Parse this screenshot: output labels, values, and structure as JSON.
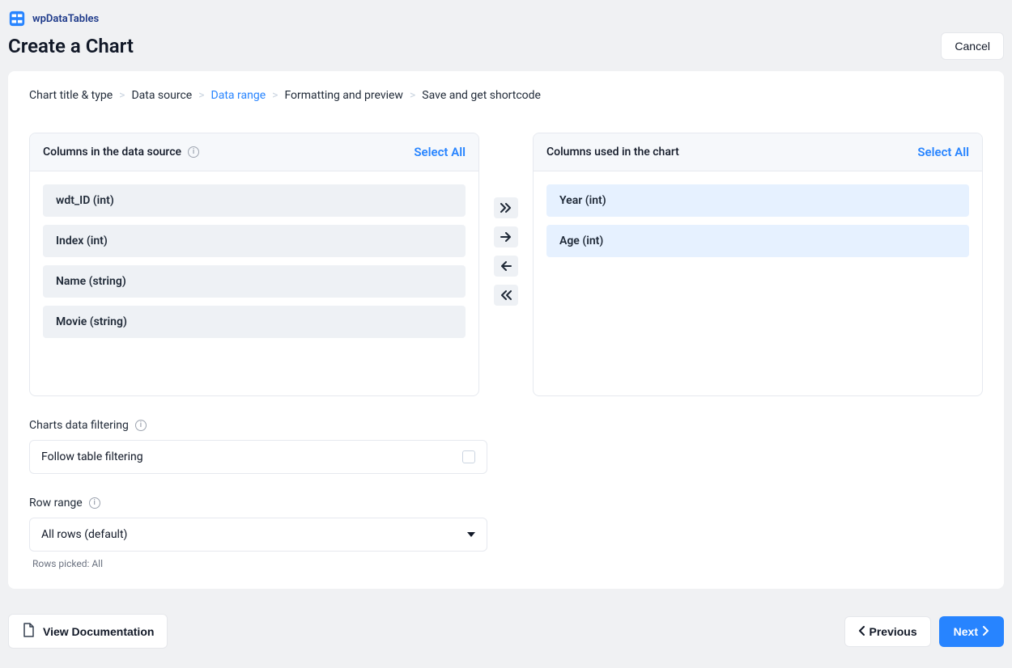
{
  "brand": {
    "name": "wpDataTables"
  },
  "page": {
    "title": "Create a Chart"
  },
  "actions": {
    "cancel": "Cancel"
  },
  "breadcrumb": {
    "items": [
      {
        "label": "Chart title & type",
        "active": false
      },
      {
        "label": "Data source",
        "active": false
      },
      {
        "label": "Data range",
        "active": true
      },
      {
        "label": "Formatting and preview",
        "active": false
      },
      {
        "label": "Save and get shortcode",
        "active": false
      }
    ]
  },
  "source_panel": {
    "title": "Columns in the data source",
    "select_all": "Select All",
    "items": [
      {
        "label": "wdt_ID (int)"
      },
      {
        "label": "Index (int)"
      },
      {
        "label": "Name (string)"
      },
      {
        "label": "Movie (string)"
      }
    ]
  },
  "chart_panel": {
    "title": "Columns used in the chart",
    "select_all": "Select All",
    "items": [
      {
        "label": "Year (int)"
      },
      {
        "label": "Age (int)"
      }
    ]
  },
  "filtering": {
    "section_label": "Charts data filtering",
    "option_label": "Follow table filtering"
  },
  "row_range": {
    "section_label": "Row range",
    "selected": "All rows (default)",
    "hint": "Rows picked: All"
  },
  "footer": {
    "docs": "View Documentation",
    "prev": "Previous",
    "next": "Next"
  }
}
